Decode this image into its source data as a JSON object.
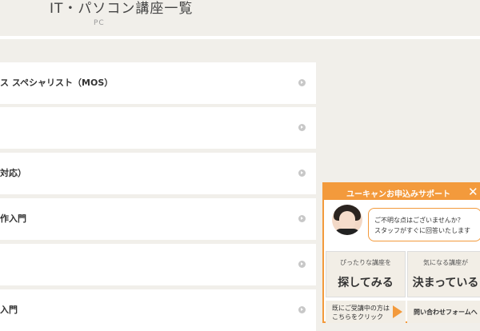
{
  "header": {
    "title": "IT・パソコン講座一覧",
    "subtitle": "PC"
  },
  "course_list": {
    "items": [
      {
        "label": "ス スペシャリスト（MOS）"
      },
      {
        "label": ""
      },
      {
        "label": "対応）"
      },
      {
        "label": "作入門"
      },
      {
        "label": ""
      },
      {
        "label": "入門"
      }
    ]
  },
  "support": {
    "title": "ユーキャンお申込みサポート",
    "close_label": "✕",
    "bubble_line1": "ご不明な点はございませんか？",
    "bubble_line2": "スタッフがすぐに回答いたします",
    "find_button": {
      "small": "ぴったりな講座を",
      "big": "探してみる"
    },
    "decided_button": {
      "small": "気になる講座が",
      "big": "決まっている"
    },
    "enrolled_line1": "既にご受講中の方は",
    "enrolled_line2": "こちらをクリック",
    "inquiry_label": "問い合わせフォームへ"
  }
}
